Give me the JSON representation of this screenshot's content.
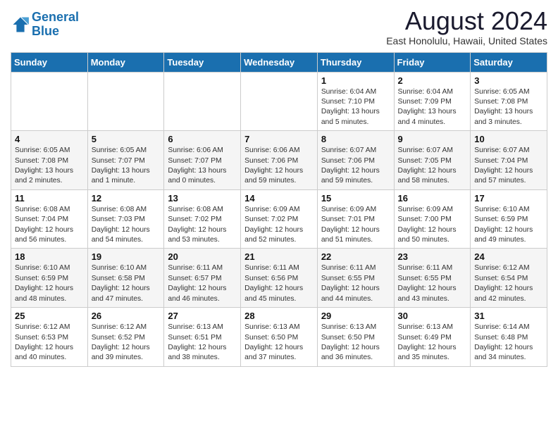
{
  "header": {
    "logo_line1": "General",
    "logo_line2": "Blue",
    "month_year": "August 2024",
    "location": "East Honolulu, Hawaii, United States"
  },
  "days_of_week": [
    "Sunday",
    "Monday",
    "Tuesday",
    "Wednesday",
    "Thursday",
    "Friday",
    "Saturday"
  ],
  "weeks": [
    [
      {
        "day": "",
        "info": ""
      },
      {
        "day": "",
        "info": ""
      },
      {
        "day": "",
        "info": ""
      },
      {
        "day": "",
        "info": ""
      },
      {
        "day": "1",
        "info": "Sunrise: 6:04 AM\nSunset: 7:10 PM\nDaylight: 13 hours\nand 5 minutes."
      },
      {
        "day": "2",
        "info": "Sunrise: 6:04 AM\nSunset: 7:09 PM\nDaylight: 13 hours\nand 4 minutes."
      },
      {
        "day": "3",
        "info": "Sunrise: 6:05 AM\nSunset: 7:08 PM\nDaylight: 13 hours\nand 3 minutes."
      }
    ],
    [
      {
        "day": "4",
        "info": "Sunrise: 6:05 AM\nSunset: 7:08 PM\nDaylight: 13 hours\nand 2 minutes."
      },
      {
        "day": "5",
        "info": "Sunrise: 6:05 AM\nSunset: 7:07 PM\nDaylight: 13 hours\nand 1 minute."
      },
      {
        "day": "6",
        "info": "Sunrise: 6:06 AM\nSunset: 7:07 PM\nDaylight: 13 hours\nand 0 minutes."
      },
      {
        "day": "7",
        "info": "Sunrise: 6:06 AM\nSunset: 7:06 PM\nDaylight: 12 hours\nand 59 minutes."
      },
      {
        "day": "8",
        "info": "Sunrise: 6:07 AM\nSunset: 7:06 PM\nDaylight: 12 hours\nand 59 minutes."
      },
      {
        "day": "9",
        "info": "Sunrise: 6:07 AM\nSunset: 7:05 PM\nDaylight: 12 hours\nand 58 minutes."
      },
      {
        "day": "10",
        "info": "Sunrise: 6:07 AM\nSunset: 7:04 PM\nDaylight: 12 hours\nand 57 minutes."
      }
    ],
    [
      {
        "day": "11",
        "info": "Sunrise: 6:08 AM\nSunset: 7:04 PM\nDaylight: 12 hours\nand 56 minutes."
      },
      {
        "day": "12",
        "info": "Sunrise: 6:08 AM\nSunset: 7:03 PM\nDaylight: 12 hours\nand 54 minutes."
      },
      {
        "day": "13",
        "info": "Sunrise: 6:08 AM\nSunset: 7:02 PM\nDaylight: 12 hours\nand 53 minutes."
      },
      {
        "day": "14",
        "info": "Sunrise: 6:09 AM\nSunset: 7:02 PM\nDaylight: 12 hours\nand 52 minutes."
      },
      {
        "day": "15",
        "info": "Sunrise: 6:09 AM\nSunset: 7:01 PM\nDaylight: 12 hours\nand 51 minutes."
      },
      {
        "day": "16",
        "info": "Sunrise: 6:09 AM\nSunset: 7:00 PM\nDaylight: 12 hours\nand 50 minutes."
      },
      {
        "day": "17",
        "info": "Sunrise: 6:10 AM\nSunset: 6:59 PM\nDaylight: 12 hours\nand 49 minutes."
      }
    ],
    [
      {
        "day": "18",
        "info": "Sunrise: 6:10 AM\nSunset: 6:59 PM\nDaylight: 12 hours\nand 48 minutes."
      },
      {
        "day": "19",
        "info": "Sunrise: 6:10 AM\nSunset: 6:58 PM\nDaylight: 12 hours\nand 47 minutes."
      },
      {
        "day": "20",
        "info": "Sunrise: 6:11 AM\nSunset: 6:57 PM\nDaylight: 12 hours\nand 46 minutes."
      },
      {
        "day": "21",
        "info": "Sunrise: 6:11 AM\nSunset: 6:56 PM\nDaylight: 12 hours\nand 45 minutes."
      },
      {
        "day": "22",
        "info": "Sunrise: 6:11 AM\nSunset: 6:55 PM\nDaylight: 12 hours\nand 44 minutes."
      },
      {
        "day": "23",
        "info": "Sunrise: 6:11 AM\nSunset: 6:55 PM\nDaylight: 12 hours\nand 43 minutes."
      },
      {
        "day": "24",
        "info": "Sunrise: 6:12 AM\nSunset: 6:54 PM\nDaylight: 12 hours\nand 42 minutes."
      }
    ],
    [
      {
        "day": "25",
        "info": "Sunrise: 6:12 AM\nSunset: 6:53 PM\nDaylight: 12 hours\nand 40 minutes."
      },
      {
        "day": "26",
        "info": "Sunrise: 6:12 AM\nSunset: 6:52 PM\nDaylight: 12 hours\nand 39 minutes."
      },
      {
        "day": "27",
        "info": "Sunrise: 6:13 AM\nSunset: 6:51 PM\nDaylight: 12 hours\nand 38 minutes."
      },
      {
        "day": "28",
        "info": "Sunrise: 6:13 AM\nSunset: 6:50 PM\nDaylight: 12 hours\nand 37 minutes."
      },
      {
        "day": "29",
        "info": "Sunrise: 6:13 AM\nSunset: 6:50 PM\nDaylight: 12 hours\nand 36 minutes."
      },
      {
        "day": "30",
        "info": "Sunrise: 6:13 AM\nSunset: 6:49 PM\nDaylight: 12 hours\nand 35 minutes."
      },
      {
        "day": "31",
        "info": "Sunrise: 6:14 AM\nSunset: 6:48 PM\nDaylight: 12 hours\nand 34 minutes."
      }
    ]
  ]
}
